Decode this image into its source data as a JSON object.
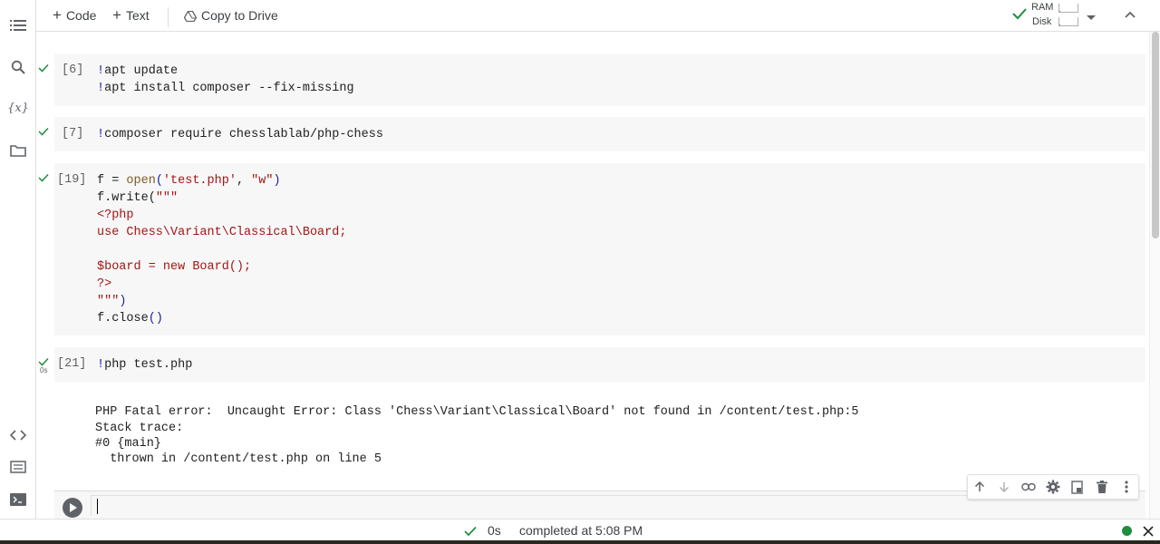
{
  "toolbar": {
    "add_code_label": "Code",
    "add_text_label": "Text",
    "copy_drive_label": "Copy to Drive",
    "ram_label": "RAM",
    "disk_label": "Disk",
    "ram_usage": 0.05,
    "disk_usage": 0.05
  },
  "sidebar": {
    "icons": [
      "table-of-contents-icon",
      "search-icon",
      "variables-icon",
      "folder-icon",
      "code-snippets-icon",
      "command-palette-icon",
      "terminal-icon"
    ],
    "variables_glyph": "{x}"
  },
  "cells": [
    {
      "execution_count": "[6]",
      "status": "completed",
      "lines": [
        {
          "bang": "!",
          "code": "apt update"
        },
        {
          "bang": "!",
          "code": "apt install composer --fix-missing"
        }
      ]
    },
    {
      "execution_count": "[7]",
      "status": "completed",
      "lines": [
        {
          "bang": "!",
          "code": "composer require chesslablab/php-chess"
        }
      ]
    },
    {
      "execution_count": "[19]",
      "status": "completed",
      "lines": [
        {
          "a": "f = ",
          "fn": "open",
          "p1": "(",
          "s1": "'test.php'",
          "sep": ", ",
          "s2": "\"w\"",
          "p2": ")"
        },
        {
          "a": "f.write(",
          "s": "\"\"\""
        },
        {
          "s": "<?php"
        },
        {
          "s": "use Chess\\Variant\\Classical\\Board;"
        },
        {
          "s": ""
        },
        {
          "s": "$board = new Board();"
        },
        {
          "s": "?>"
        },
        {
          "s": "\"\"\"",
          "p": ")"
        },
        {
          "a": "f.close",
          "p": "()"
        }
      ]
    },
    {
      "execution_count": "[21]",
      "status": "completed",
      "duration": "0s",
      "lines": [
        {
          "bang": "!",
          "code": "php test.php"
        }
      ],
      "output": [
        "PHP Fatal error:  Uncaught Error: Class 'Chess\\Variant\\Classical\\Board' not found in /content/test.php:5",
        "Stack trace:",
        "#0 {main}",
        "  thrown in /content/test.php on line 5"
      ]
    }
  ],
  "active_cell": {
    "value": ""
  },
  "cell_toolbar": {
    "icons": [
      "move-up-icon",
      "move-down-icon",
      "link-icon",
      "settings-icon",
      "mirror-cell-icon",
      "delete-icon",
      "more-vert-icon"
    ]
  },
  "statusbar": {
    "duration": "0s",
    "text": "completed at 5:08 PM"
  },
  "colors": {
    "success": "#1e8e3e",
    "keyword_bang": "#1a1aa6",
    "string": "#a31515",
    "function": "#795e26",
    "cell_bg": "#f7f7f7"
  }
}
